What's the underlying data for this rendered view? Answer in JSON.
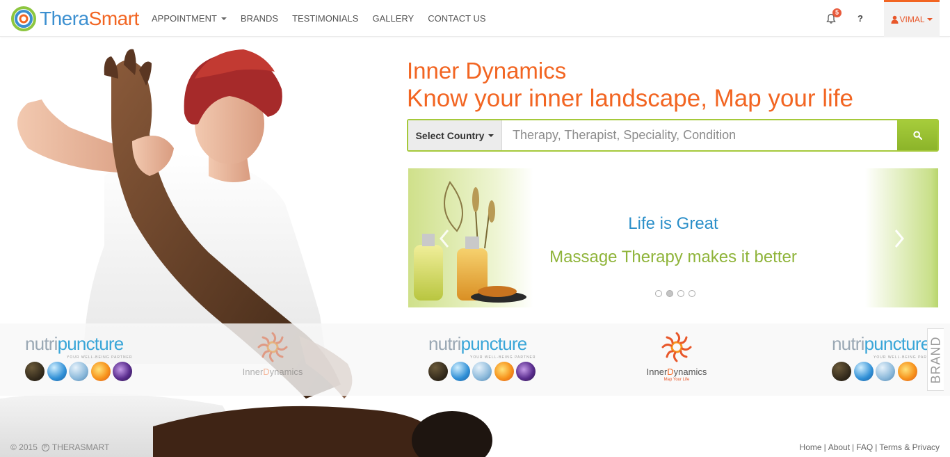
{
  "brand": {
    "name_part1": "Thera",
    "name_part2": "Smart"
  },
  "nav": {
    "items": [
      {
        "label": "APPOINTMENT",
        "dropdown": true
      },
      {
        "label": "BRANDS"
      },
      {
        "label": "TESTIMONIALS"
      },
      {
        "label": "GALLERY"
      },
      {
        "label": "CONTACT US"
      }
    ],
    "notifications_count": "5",
    "help_label": "?",
    "user_label": "VIMAL"
  },
  "hero": {
    "line1": "Inner Dynamics",
    "line2": "Know your inner landscape, Map your life"
  },
  "search": {
    "country_label": "Select Country",
    "placeholder": "Therapy, Therapist, Speciality, Condition",
    "value": ""
  },
  "carousel": {
    "title": "Life is Great",
    "subtitle": "Massage Therapy makes it better",
    "slide_count": 4,
    "active_index": 1
  },
  "brands": {
    "nutripuncture": {
      "part1": "nutri",
      "part2": "puncture",
      "tagline": "YOUR WELL-BEING PARTNER"
    },
    "innerdynamics": {
      "part1": "Inner",
      "part2": "D",
      "part3": "ynamics",
      "tagline": "Map Your Life"
    },
    "tab_label": "BRAND"
  },
  "footer": {
    "copyright": "© 2015",
    "company": "THERASMART",
    "links": [
      "Home",
      "About",
      "FAQ",
      "Terms & Privacy"
    ]
  },
  "colors": {
    "accent_orange": "#f26522",
    "accent_green": "#a5c93a",
    "accent_blue": "#2b8fc9"
  }
}
